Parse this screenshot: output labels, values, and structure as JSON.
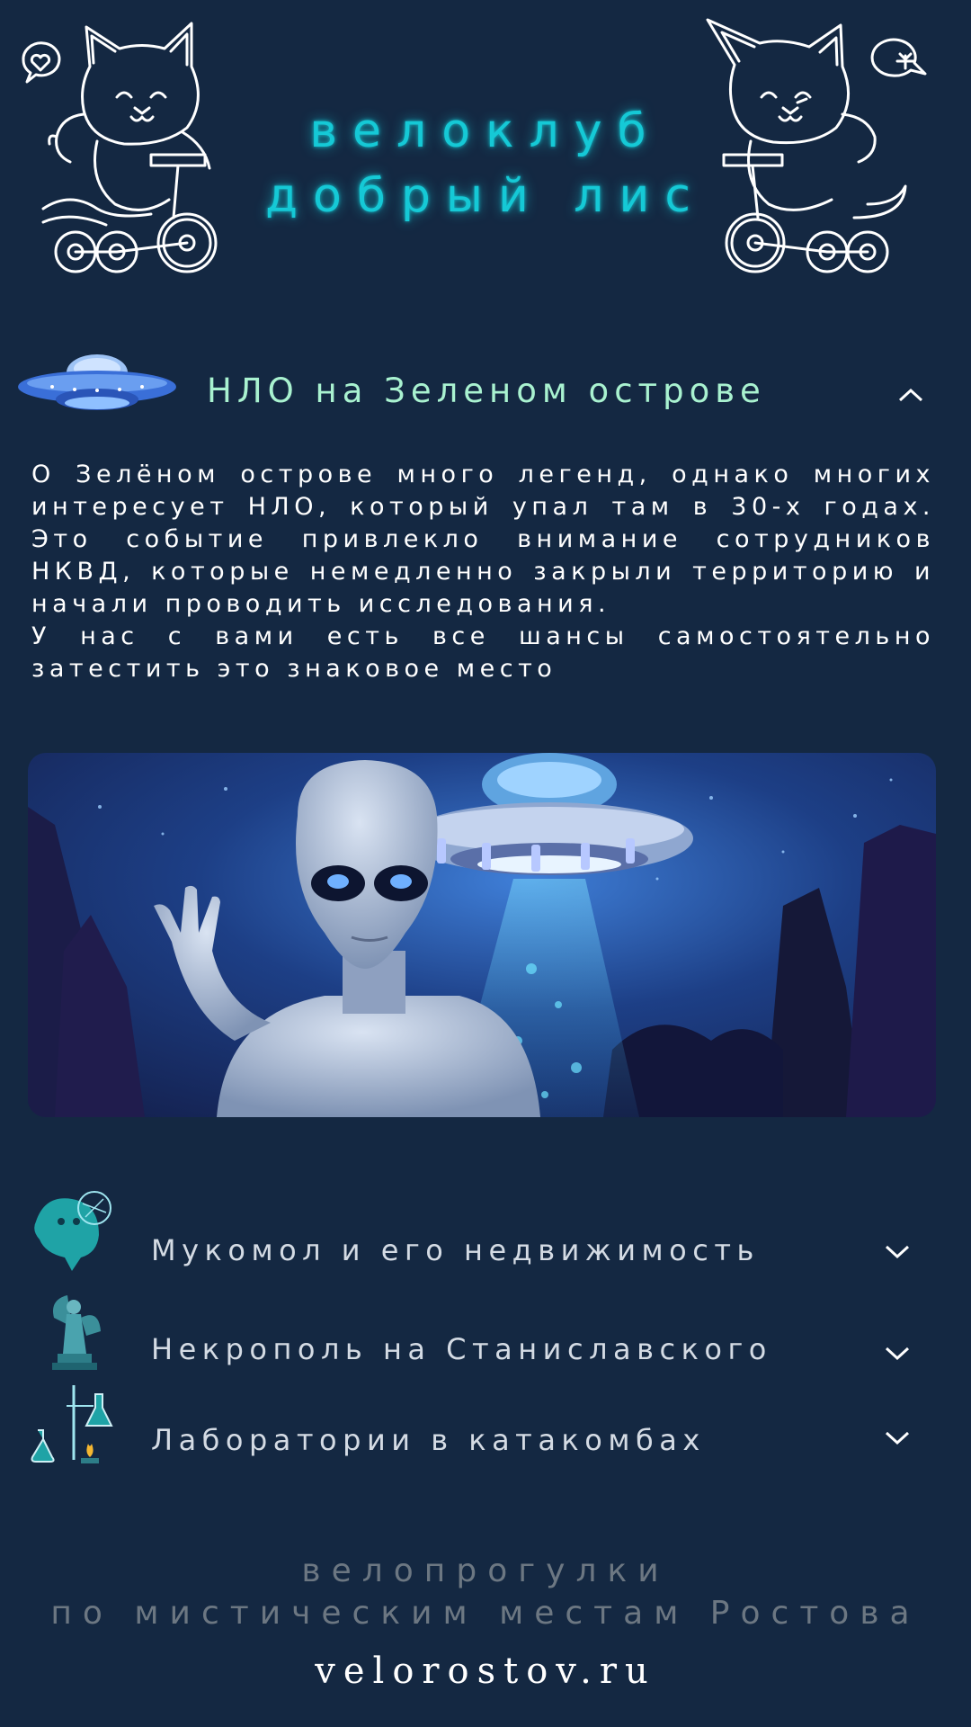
{
  "header": {
    "title_line1": "велоклуб",
    "title_line2": "добрый лис",
    "left_icon": "cat-on-bicycle-heart-icon",
    "right_icon": "cat-on-bicycle-leaf-icon"
  },
  "expanded_section": {
    "icon": "ufo-icon",
    "title": "НЛО на Зеленом острове",
    "toggle_icon": "chevron-up-icon",
    "paragraph1": "О Зелёном острове много легенд, однако многих интересует НЛО, который упал там в 30-х годах. Это событие привлекло внимание сотрудников НКВД, которые немедленно закрыли территорию и начали проводить исследования.",
    "paragraph2": "У нас с вами есть все шансы самостоятельно затестить это знаковое место",
    "illustration": "alien-and-ufo-illustration"
  },
  "sections": [
    {
      "icon": "ghost-icon",
      "label": "Мукомол и его недвижимость",
      "toggle_icon": "chevron-down-icon"
    },
    {
      "icon": "angel-statue-icon",
      "label": "Некрополь на Станиславского",
      "toggle_icon": "chevron-down-icon"
    },
    {
      "icon": "lab-flasks-icon",
      "label": "Лаборатории в катакомбах",
      "toggle_icon": "chevron-down-icon"
    }
  ],
  "footer": {
    "line1": "велопрогулки",
    "line2": "по мистическим местам Ростова",
    "site": "velorostov.ru"
  },
  "colors": {
    "background": "#142842",
    "title_glow": "#15c9d6",
    "section_title": "#a9f2d0",
    "footer_text": "#6c7782"
  }
}
